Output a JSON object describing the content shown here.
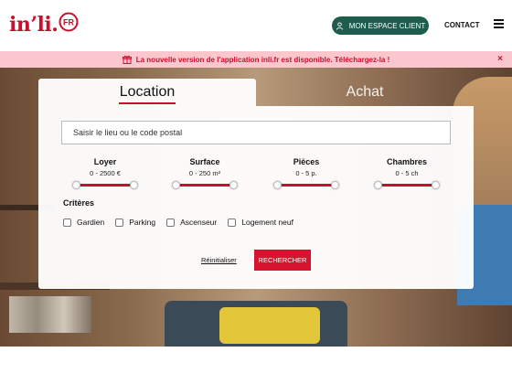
{
  "header": {
    "logo_text": "in’li.",
    "logo_badge": "FR",
    "espace_client_label": "MON ESPACE CLIENT",
    "contact_label": "CONTACT"
  },
  "banner": {
    "message": "La nouvelle version de l'application inli.fr est disponible. Téléchargez-la !",
    "close_label": "×"
  },
  "search": {
    "tabs": {
      "location": "Location",
      "achat": "Achat"
    },
    "active_tab": "location",
    "location_placeholder": "Saisir le lieu ou le code postal",
    "sliders": [
      {
        "title": "Loyer",
        "range": "0 - 2500 €"
      },
      {
        "title": "Surface",
        "range": "0 - 250 m²"
      },
      {
        "title": "Pièces",
        "range": "0 - 5 p."
      },
      {
        "title": "Chambres",
        "range": "0 - 5 ch"
      }
    ],
    "criteres_title": "Critères",
    "criteres": [
      "Gardien",
      "Parking",
      "Ascenseur",
      "Logement neuf"
    ],
    "reset_label": "Réinitialiser",
    "submit_label": "RECHERCHER"
  },
  "colors": {
    "brand_red": "#c8102e",
    "button_green": "#1e5c4e",
    "banner_pink": "#f9c7cd"
  },
  "icons": {
    "espace_client": "user-icon",
    "banner": "gift-icon",
    "menu": "hamburger-icon"
  }
}
